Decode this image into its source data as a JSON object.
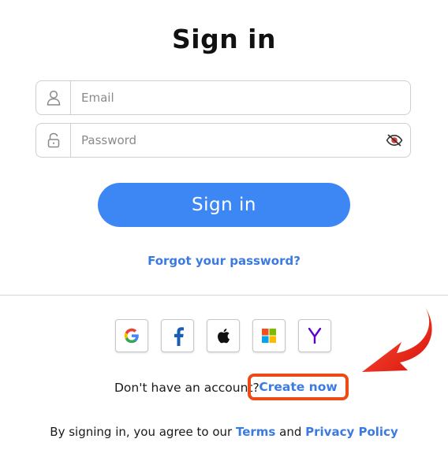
{
  "heading": "Sign in",
  "email": {
    "placeholder": "Email",
    "value": ""
  },
  "password": {
    "placeholder": "Password",
    "value": ""
  },
  "signin_button": "Sign in",
  "forgot_link": "Forgot your password?",
  "social": [
    {
      "name": "google",
      "glyph": "G"
    },
    {
      "name": "facebook",
      "glyph": "f"
    },
    {
      "name": "apple",
      "glyph": "apple-icon"
    },
    {
      "name": "microsoft",
      "glyph": "microsoft-icon"
    },
    {
      "name": "yahoo",
      "glyph": "Y"
    }
  ],
  "signup": {
    "prompt": "Don't have an account?",
    "link": "Create now"
  },
  "legal": {
    "prefix": "By signing in, you agree to our",
    "terms": "Terms",
    "and": "and",
    "privacy": "Privacy Policy"
  },
  "colors": {
    "primary": "#3d87f5",
    "link": "#3b7be0",
    "highlight": "#ee4a16",
    "arrow": "#e8190e"
  }
}
